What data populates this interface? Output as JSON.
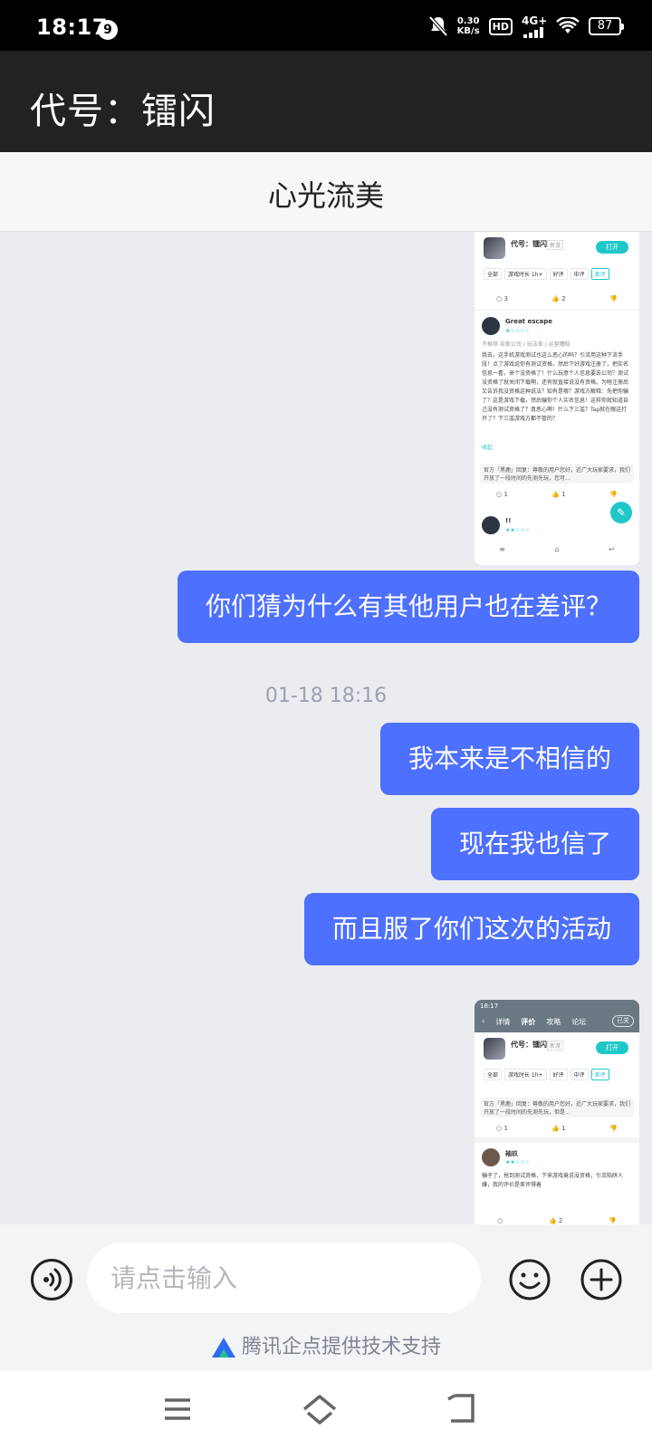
{
  "status_bar": {
    "time": "18:17",
    "notification_count": "9",
    "net_speed_value": "0.30",
    "net_speed_unit": "KB/s",
    "hd": "HD",
    "network": "4G+",
    "battery": "87"
  },
  "app_bar": {
    "title": "代号：镭闪"
  },
  "chat": {
    "title": "心光流美"
  },
  "screenshot_1": {
    "game_name": "代号：镭闪",
    "game_tag": "新游",
    "open_label": "打开",
    "filters": [
      "全部",
      "游戏时长 1h+",
      "好评",
      "中评",
      "差评"
    ],
    "top_actions": [
      "3",
      "2",
      ""
    ],
    "reviewer": "Great escape",
    "review_note": "不推荐  自家公司 / 玩法差 / 运营糟糕",
    "review_text": "我去，这手机游戏测试也这么恶心的吗？引流用这种下流手段！点了游戏说你有测试资格，然后下好游戏注册了，把实名信息一看，来个没资格了！什么玩意个人信息要去公司？测试没资格了就关闭下载啊，还有就直接说没有资格。为啥注册后又告诉我没资格这种说法？知有是哪？游戏方解释：先把你骗了？这是游戏下载，然后骗你个人实名信息！这样你就知道自己没有测试资格了？真恶心啊！什么下三滥？Tap就在眼这打开了？下三滥游戏方都不管的？",
    "expand_label": "收起",
    "official_reply": "官方「黑鹿」回复：尊敬的用户您好，近广大玩家要求，我们开放了一段时间的先测先玩，您可...",
    "bottom_actions": [
      "1",
      "1",
      ""
    ],
    "reviewer2": "!!"
  },
  "screenshot_2": {
    "time": "18:17",
    "tabs": [
      "详情",
      "评价",
      "攻略",
      "论坛"
    ],
    "follow_label": "已关",
    "game_name": "代号：镭闪",
    "game_tag": "新游",
    "open_label": "打开",
    "filters": [
      "全部",
      "游戏时长 1h+",
      "好评",
      "中评",
      "差评"
    ],
    "official_reply": "官方「黑鹿」回复：尊敬的用户您好，近广大玩家要求，我们开放了一段时间的先测先玩，但是...",
    "actions": [
      "1",
      "1",
      ""
    ],
    "reviewer": "袖玖",
    "review_text": "骗子了，抢到测试资格，下来游戏竟说没资格，引流陷阱人嫌，我的评价是差评得着",
    "bottom_actions": [
      "",
      "2",
      ""
    ]
  },
  "messages": [
    {
      "text": "你们猜为什么有其他用户也在差评？"
    },
    {
      "text": "我本来是不相信的"
    },
    {
      "text": "现在我也信了"
    },
    {
      "text": "而且服了你们这次的活动"
    }
  ],
  "timestamp": "01-18 18:16",
  "input": {
    "placeholder": "请点击输入"
  },
  "footer": {
    "text": "腾讯企点提供技术支持"
  },
  "icons": {
    "voice": "voice-icon",
    "emoji": "emoji-icon",
    "add": "plus-icon",
    "menu": "menu-icon",
    "home": "home-icon",
    "back": "back-icon"
  }
}
